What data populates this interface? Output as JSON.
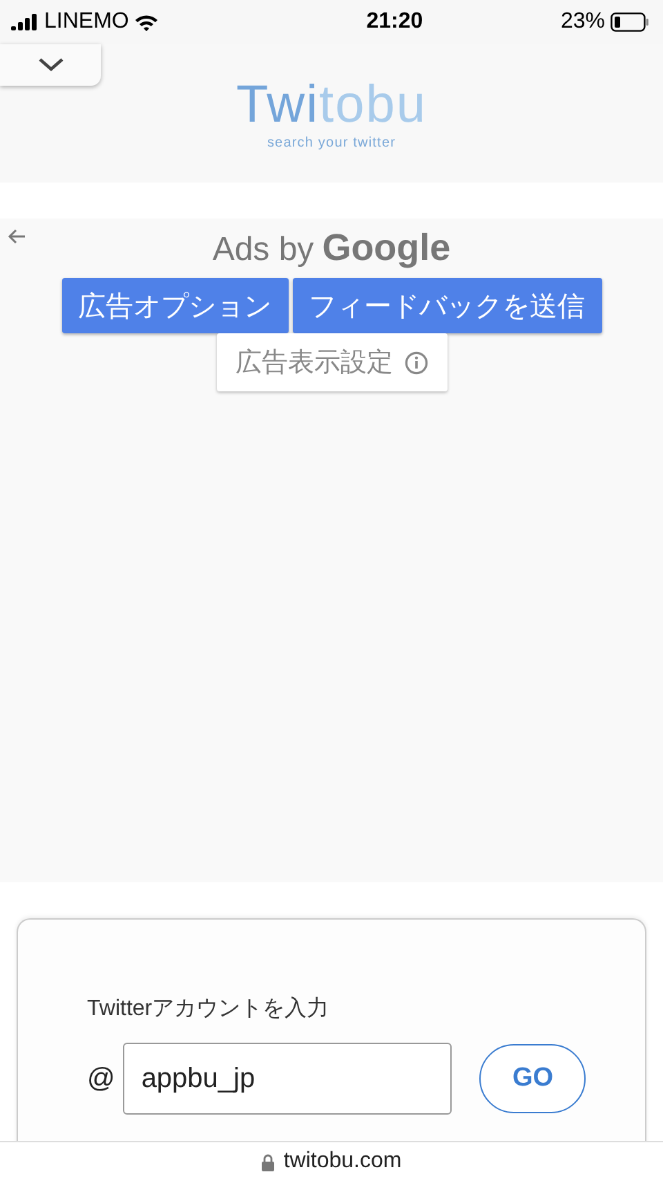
{
  "status_bar": {
    "carrier": "LINEMO",
    "time": "21:20",
    "battery": "23%"
  },
  "header": {
    "logo": [
      "Twi",
      "tobu"
    ],
    "tagline": "search your twitter"
  },
  "ad": {
    "title_prefix": "Ads by",
    "title_brand": "Google",
    "buttons": [
      "広告オプション",
      "フィードバックを送信"
    ],
    "settings": "広告表示設定"
  },
  "form": {
    "label": "Twitterアカウントを入力",
    "at": "@",
    "value": "appbu_jp",
    "submit": "GO"
  },
  "address_bar": {
    "url": "twitobu.com"
  }
}
